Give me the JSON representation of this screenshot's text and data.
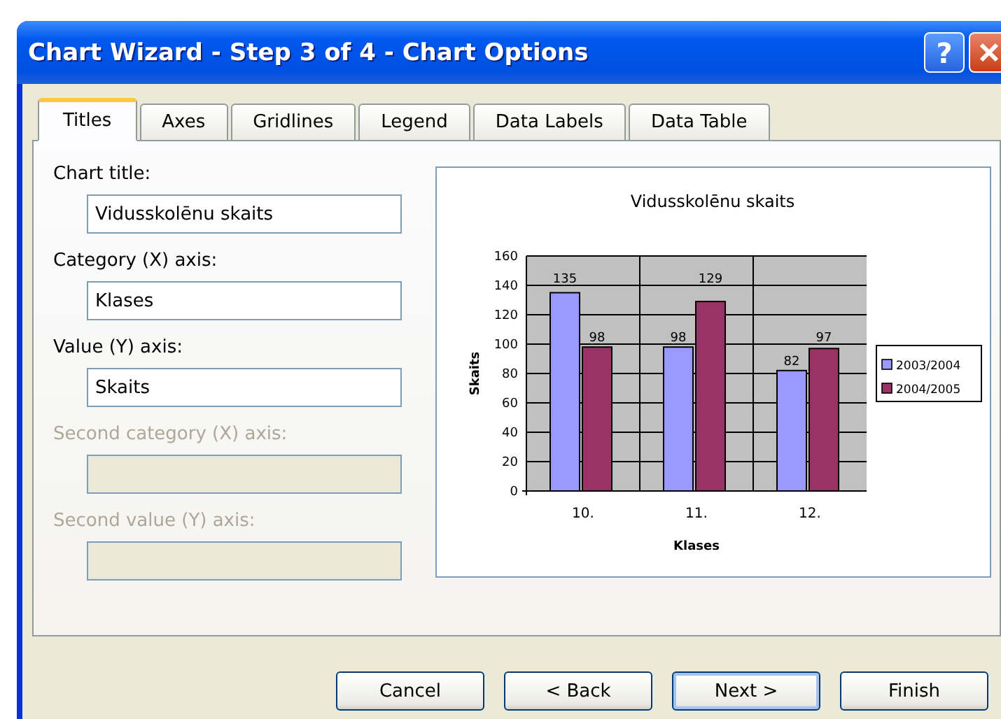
{
  "window": {
    "title": "Chart Wizard - Step 3 of 4 - Chart Options",
    "help_button": "?"
  },
  "tabs": [
    {
      "label": "Titles",
      "selected": true
    },
    {
      "label": "Axes",
      "selected": false
    },
    {
      "label": "Gridlines",
      "selected": false
    },
    {
      "label": "Legend",
      "selected": false
    },
    {
      "label": "Data Labels",
      "selected": false
    },
    {
      "label": "Data Table",
      "selected": false
    }
  ],
  "fields": [
    {
      "label": "Chart title:",
      "value": "Vidusskolēnu skaits",
      "disabled": false
    },
    {
      "label": "Category (X) axis:",
      "value": "Klases",
      "disabled": false
    },
    {
      "label": "Value (Y) axis:",
      "value": "Skaits",
      "disabled": false
    },
    {
      "label": "Second category (X) axis:",
      "disabled": true
    },
    {
      "label": "Second value (Y) axis:",
      "disabled": true
    }
  ],
  "preview": {
    "chart_data": {
      "type": "bar",
      "title": "Vidusskolēnu skaits",
      "xlabel": "Klases",
      "ylabel": "Skaits",
      "categories": [
        "10.",
        "11.",
        "12."
      ],
      "series": [
        {
          "name": "2003/2004",
          "color": "#9999ff",
          "values": [
            135,
            98,
            82
          ]
        },
        {
          "name": "2004/2005",
          "color": "#993366",
          "values": [
            98,
            129,
            97
          ]
        }
      ],
      "ylim": [
        0,
        160
      ],
      "yticks": [
        0,
        20,
        40,
        60,
        80,
        100,
        120,
        140,
        160
      ],
      "data_labels": true,
      "grid": true,
      "legend": true
    }
  },
  "buttons": [
    {
      "label": "Cancel",
      "default": false
    },
    {
      "label": "< Back",
      "default": false
    },
    {
      "label": "Next >",
      "default": true
    },
    {
      "label": "Finish",
      "default": false
    }
  ]
}
